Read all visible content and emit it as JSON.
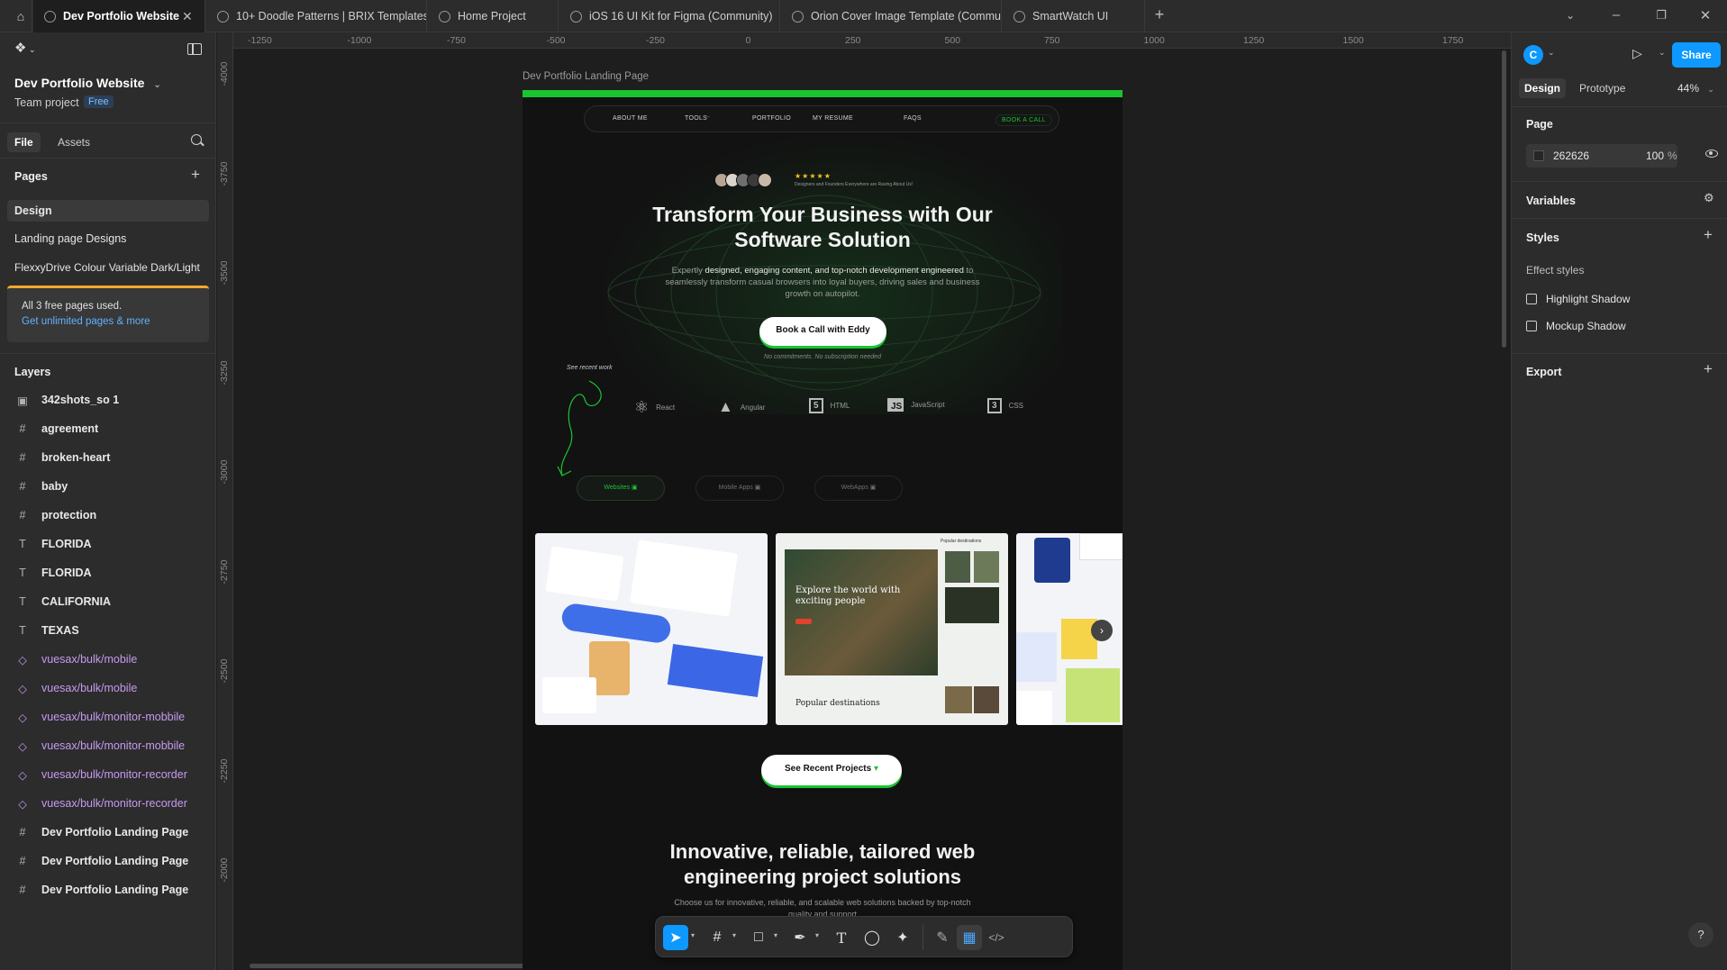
{
  "tabs": [
    {
      "label": "Dev Portfolio Website",
      "active": true
    },
    {
      "label": "10+ Doodle Patterns | BRIX Templates"
    },
    {
      "label": "Home Project"
    },
    {
      "label": "iOS 16 UI Kit for Figma (Community)"
    },
    {
      "label": "Orion Cover Image Template (Commu"
    },
    {
      "label": "SmartWatch UI"
    }
  ],
  "file": {
    "name": "Dev Portfolio Website",
    "team": "Team project",
    "plan": "Free"
  },
  "leftTabs": {
    "file": "File",
    "assets": "Assets"
  },
  "pages": {
    "title": "Pages",
    "items": [
      "Design",
      "Landing page Designs",
      "FlexxyDrive Colour Variable Dark/Light"
    ],
    "banner": {
      "text": "All 3 free pages used.",
      "link": "Get unlimited pages & more"
    }
  },
  "layers": {
    "title": "Layers",
    "items": [
      {
        "icon": "image-icon",
        "glyph": "▣",
        "label": "342shots_so 1",
        "type": "img"
      },
      {
        "icon": "frame-icon",
        "glyph": "#",
        "label": "agreement",
        "type": "frame"
      },
      {
        "icon": "frame-icon",
        "glyph": "#",
        "label": "broken-heart",
        "type": "frame"
      },
      {
        "icon": "frame-icon",
        "glyph": "#",
        "label": "baby",
        "type": "frame"
      },
      {
        "icon": "frame-icon",
        "glyph": "#",
        "label": "protection",
        "type": "frame"
      },
      {
        "icon": "text-icon",
        "glyph": "T",
        "label": "FLORIDA",
        "type": "text"
      },
      {
        "icon": "text-icon",
        "glyph": "T",
        "label": "FLORIDA",
        "type": "text"
      },
      {
        "icon": "text-icon",
        "glyph": "T",
        "label": "CALIFORNIA",
        "type": "text"
      },
      {
        "icon": "text-icon",
        "glyph": "T",
        "label": "TEXAS",
        "type": "text"
      },
      {
        "icon": "component-icon",
        "glyph": "◇",
        "label": "vuesax/bulk/mobile",
        "type": "comp"
      },
      {
        "icon": "component-icon",
        "glyph": "◇",
        "label": "vuesax/bulk/mobile",
        "type": "comp"
      },
      {
        "icon": "component-icon",
        "glyph": "◇",
        "label": "vuesax/bulk/monitor-mobbile",
        "type": "comp"
      },
      {
        "icon": "component-icon",
        "glyph": "◇",
        "label": "vuesax/bulk/monitor-mobbile",
        "type": "comp"
      },
      {
        "icon": "component-icon",
        "glyph": "◇",
        "label": "vuesax/bulk/monitor-recorder",
        "type": "comp"
      },
      {
        "icon": "component-icon",
        "glyph": "◇",
        "label": "vuesax/bulk/monitor-recorder",
        "type": "comp"
      },
      {
        "icon": "frame-icon",
        "glyph": "#",
        "label": "Dev Portfolio Landing Page",
        "type": "frame"
      },
      {
        "icon": "frame-icon",
        "glyph": "#",
        "label": "Dev Portfolio Landing Page",
        "type": "frame"
      },
      {
        "icon": "frame-icon",
        "glyph": "#",
        "label": "Dev Portfolio Landing Page",
        "type": "frame"
      }
    ]
  },
  "ruler": {
    "h": [
      "-1250",
      "-1000",
      "-750",
      "-500",
      "-250",
      "0",
      "250",
      "500",
      "750",
      "1000",
      "1250",
      "1500",
      "1750"
    ],
    "v": [
      "-4000",
      "-3750",
      "-3500",
      "-3250",
      "-3000",
      "-2750",
      "-2500",
      "-2250",
      "-2000"
    ]
  },
  "frameLabel": "Dev Portfolio Landing Page",
  "landing": {
    "nav": [
      "ABOUT ME",
      "TOOLS",
      "PORTFOLIO",
      "MY RESUME",
      "FAQS"
    ],
    "navCta": "BOOK A CALL",
    "stars": "★★★★★",
    "reviewText": "Designers and Founders Everywhere are Raving About Us!",
    "heroTitle1": "Transform Your Business with Our",
    "heroTitle2": "Software Solution",
    "heroSub1a": "Expertly ",
    "heroSub1b": "designed, engaging content, and top-notch development engineered",
    "heroSub1c": " to",
    "heroSub2": "seamlessly transform casual browsers into loyal buyers, driving sales and business",
    "heroSub3": "growth on autopilot.",
    "cta": "Book a Call with Eddy",
    "ctaNote": "No commitments. No subscription needed",
    "recentNote": "See recent work",
    "tech": [
      "React",
      "Angular",
      "HTML",
      "JavaScript",
      "CSS"
    ],
    "filters": [
      "Websites",
      "Mobile Apps",
      "WebApps"
    ],
    "shot2Title": "Explore the world with exciting people",
    "shot2Sub": "Popular destinations",
    "shot2Side": "Popular destinations",
    "recentBtn": "See Recent Projects",
    "sec2Title1": "Innovative, reliable, tailored web",
    "sec2Title2": "engineering project solutions",
    "sec2Sub1": "Choose us for innovative, reliable, and scalable web solutions backed by top-notch",
    "sec2Sub2": "quality and support"
  },
  "right": {
    "avatar": "C",
    "share": "Share",
    "tabDesign": "Design",
    "tabPrototype": "Prototype",
    "zoom": "44%",
    "pageTitle": "Page",
    "pageColor": "262626",
    "pageOpacity": "100",
    "pct": "%",
    "variables": "Variables",
    "styles": "Styles",
    "effectStyles": "Effect styles",
    "effects": [
      "Highlight Shadow",
      "Mockup Shadow"
    ],
    "export": "Export"
  },
  "colors": {
    "accent": "#0d99ff",
    "brandGreen": "#19c431",
    "pageBg": "#262626"
  }
}
